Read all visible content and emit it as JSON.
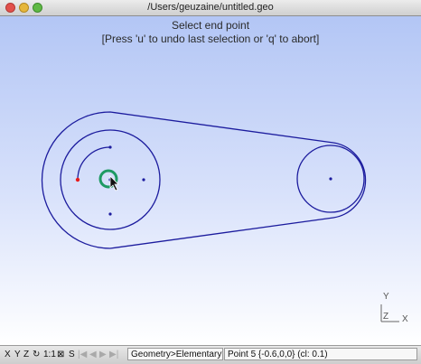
{
  "window": {
    "title": "/Users/geuzaine/untitled.geo"
  },
  "canvas": {
    "prompt_line1": "Select end point",
    "prompt_line2": "[Press 'u' to undo last selection or 'q' to abort]",
    "axis_labels": {
      "x": "X",
      "y": "Y",
      "z": "Z"
    }
  },
  "statusbar": {
    "buttons": [
      "X",
      "Y",
      "Z",
      "↻",
      "1:1",
      "⊠",
      "S"
    ],
    "nav_buttons": [
      "|◀",
      "◀",
      "▶",
      "▶|"
    ],
    "module": "Geometry>Elementary>A",
    "info": "Point 5 {-0.6,0,0} (cl: 0.1)"
  },
  "colors": {
    "curve": "#1c1c9e",
    "selected_point": "#e81b1b",
    "highlight": "#1e9a63"
  }
}
